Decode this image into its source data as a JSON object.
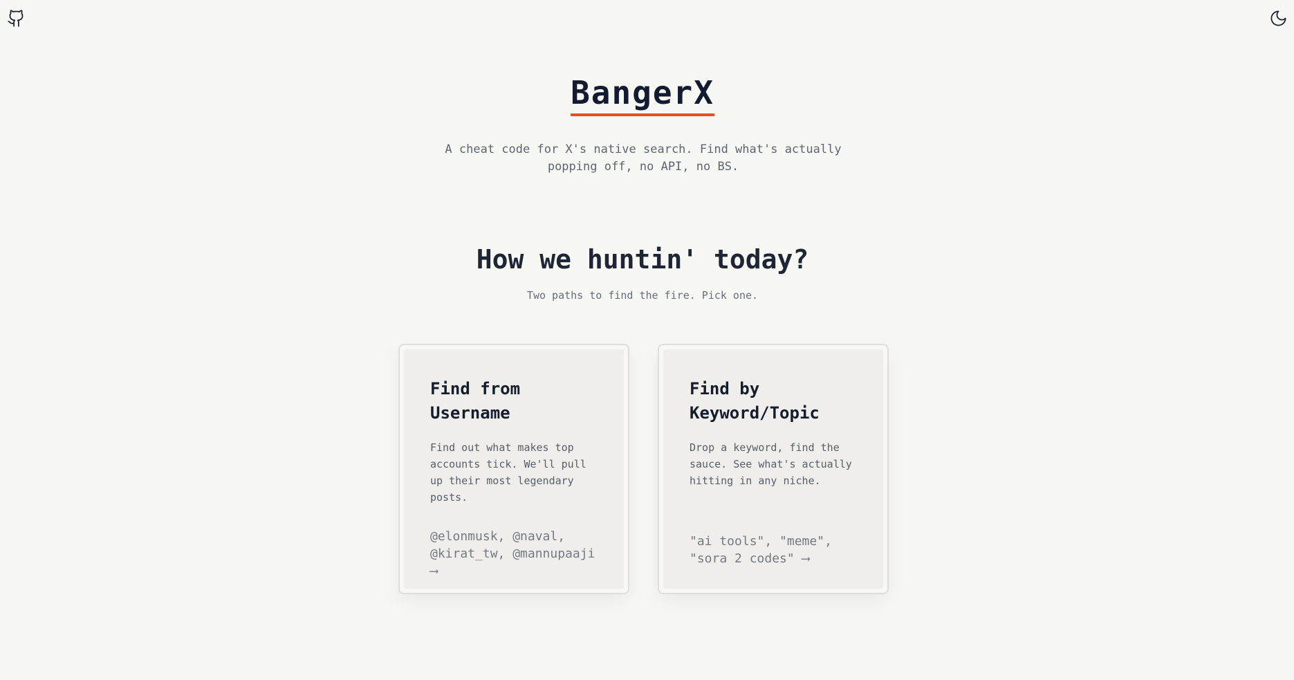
{
  "header": {
    "github_icon": "github-icon",
    "theme_icon": "moon-icon"
  },
  "brand": {
    "title": "BangerX",
    "underline_color": "#e8501f"
  },
  "tagline": "A cheat code for X's native search. Find what's actually popping off, no API, no BS.",
  "hero": {
    "heading": "How we huntin' today?",
    "subheading": "Two paths to find the fire. Pick one."
  },
  "cards": [
    {
      "title": "Find from Username",
      "description": "Find out what makes top accounts tick. We'll pull up their most legendary posts.",
      "examples": "@elonmusk, @naval, @kirat_tw, @mannupaaji ⟶"
    },
    {
      "title": "Find by Keyword/Topic",
      "description": "Drop a keyword, find the sauce. See what's actually hitting in any niche.",
      "examples": "\"ai tools\", \"meme\", \"sora 2 codes\" ⟶"
    }
  ]
}
